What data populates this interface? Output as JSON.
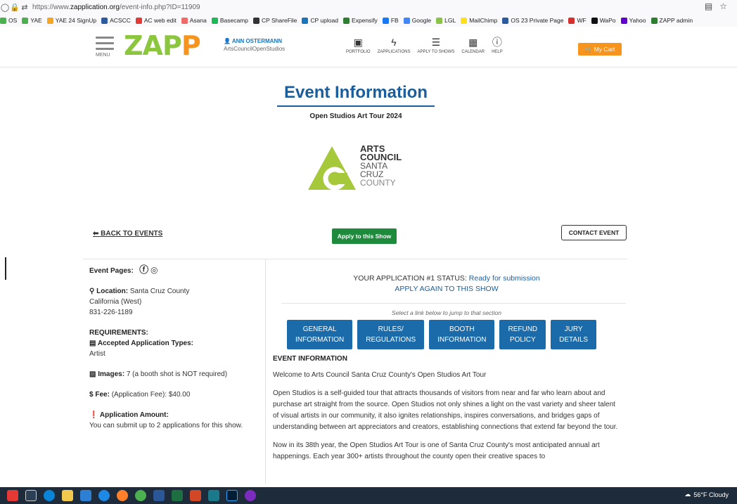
{
  "browser": {
    "url_prefix": "https://www.",
    "url_domain": "zapplication.org",
    "url_path": "/event-info.php?ID=11909"
  },
  "bookmarks": [
    {
      "label": "OS",
      "color": "#4caf50"
    },
    {
      "label": "YAE",
      "color": "#4caf50"
    },
    {
      "label": "YAE 24 SignUp",
      "color": "#f5a623"
    },
    {
      "label": "ACSCC",
      "color": "#2d5a9e"
    },
    {
      "label": "AC web edit",
      "color": "#e53935"
    },
    {
      "label": "Asana",
      "color": "#f06a6a"
    },
    {
      "label": "Basecamp",
      "color": "#1db954"
    },
    {
      "label": "CP ShareFile",
      "color": "#333333"
    },
    {
      "label": "CP upload",
      "color": "#1b75bb"
    },
    {
      "label": "Expensify",
      "color": "#2e7d32"
    },
    {
      "label": "FB",
      "color": "#1877f2"
    },
    {
      "label": "Google",
      "color": "#4285f4"
    },
    {
      "label": "LGL",
      "color": "#8bc34a"
    },
    {
      "label": "MailChimp",
      "color": "#ffe01b"
    },
    {
      "label": "OS 23 Private Page",
      "color": "#2d5a9e"
    },
    {
      "label": "WF",
      "color": "#d32f2f"
    },
    {
      "label": "WaPo",
      "color": "#111111"
    },
    {
      "label": "Yahoo",
      "color": "#6001d2"
    },
    {
      "label": "ZAPP admin",
      "color": "#2e7d32"
    }
  ],
  "header": {
    "menu_label": "MENU",
    "logo_main": "ZAP",
    "logo_end": "P",
    "user_name": "ANN OSTERMANN",
    "user_org": "ArtsCouncilOpenStudios",
    "nav": [
      {
        "label": "PORTFOLIO",
        "icon": "briefcase-icon",
        "glyph": "▣"
      },
      {
        "label": "ZAPPLICATIONS",
        "icon": "lightning-icon",
        "glyph": "ϟ"
      },
      {
        "label": "APPLY TO SHOWS",
        "icon": "list-icon",
        "glyph": "☰"
      },
      {
        "label": "CALENDAR",
        "icon": "calendar-icon",
        "glyph": "▦"
      },
      {
        "label": "HELP",
        "icon": "info-icon",
        "glyph": "ⓘ"
      }
    ],
    "cart_label": "My Cart"
  },
  "page": {
    "title": "Event Information",
    "subtitle": "Open Studios Art Tour 2024",
    "org_logo": [
      "ARTS",
      "COUNCIL",
      "SANTA",
      "CRUZ",
      "COUNTY"
    ],
    "back_label": "BACK TO EVENTS",
    "apply_label": "Apply to this Show",
    "contact_label": "CONTACT EVENT"
  },
  "left": {
    "event_pages_label": "Event Pages:",
    "location_label": "Location:",
    "location_value": "Santa Cruz County",
    "region": "California (West)",
    "phone": "831-226-1189",
    "requirements_label": "REQUIREMENTS:",
    "accepted_label": "Accepted Application Types:",
    "accepted_value": "Artist",
    "images_label": "Images:",
    "images_value": "7 (a booth shot is NOT required)",
    "fee_label": "Fee:",
    "fee_value": "(Application Fee): $40.00",
    "app_amount_label": "Application Amount:",
    "app_amount_value": "You can submit up to 2 applications for this show."
  },
  "right": {
    "status_prefix": "YOUR APPLICATION #1 STATUS: ",
    "status_value": "Ready for submission",
    "apply_again": "APPLY AGAIN TO THIS SHOW",
    "jump_hint": "Select a link below to jump to that section",
    "tabs": [
      {
        "line1": "GENERAL",
        "line2": "INFORMATION"
      },
      {
        "line1": "RULES/",
        "line2": "REGULATIONS"
      },
      {
        "line1": "BOOTH",
        "line2": "INFORMATION"
      },
      {
        "line1": "REFUND",
        "line2": "POLICY"
      },
      {
        "line1": "JURY",
        "line2": "DETAILS"
      }
    ],
    "section_head": "EVENT INFORMATION",
    "welcome": "Welcome to Arts Council Santa Cruz County's Open Studios Art Tour",
    "para1": "Open Studios is a self-guided tour that attracts thousands of visitors from near and far who learn about and purchase art straight from the source. Open Studios not only shines a light on the vast variety and sheer talent of visual artists in our community, it also ignites relationships, inspires conversations, and bridges gaps of understanding between art appreciators and creators, establishing connections that extend far beyond the tour.",
    "para2": "Now in its 38th year, the Open Studios Art Tour is one of Santa Cruz County's most anticipated annual art happenings. Each year 300+ artists throughout the county open their creative spaces to"
  },
  "taskbar": {
    "weather": "56°F Cloudy"
  }
}
